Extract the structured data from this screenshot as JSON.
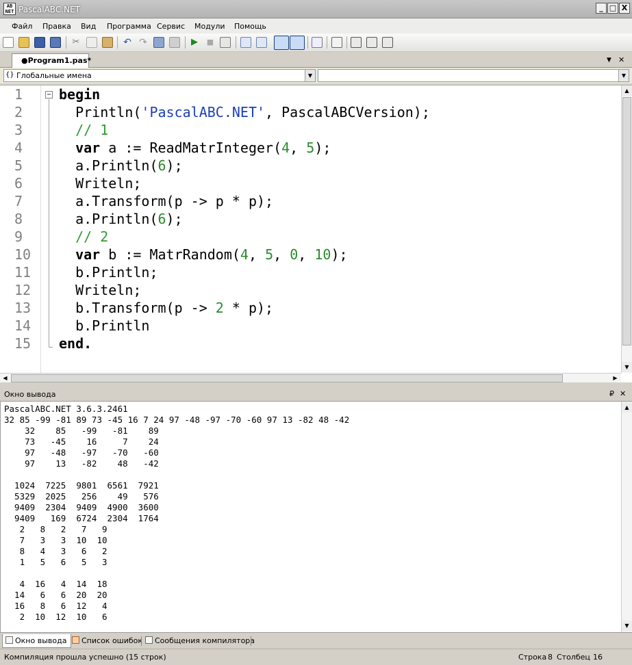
{
  "window": {
    "title": "PascalABC.NET",
    "icon_text": "AB\nNET"
  },
  "window_buttons": {
    "minimize": "_",
    "maximize": "□",
    "close": "X"
  },
  "menu": [
    "Файл",
    "Правка",
    "Вид",
    "Программа",
    "Сервис",
    "Модули",
    "Помощь"
  ],
  "toolbar": {
    "icons": [
      "new-file-icon",
      "open-file-icon",
      "save-icon",
      "save-all-icon",
      "cut-icon",
      "copy-icon",
      "paste-icon",
      "undo-icon",
      "redo-icon",
      "find-icon",
      "replace-icon",
      "run-icon",
      "stop-icon",
      "compile-icon",
      "step-over-icon",
      "step-into-icon",
      "toggle-output-icon",
      "toggle-input-icon",
      "format-icon",
      "form-designer-icon",
      "debug-1-icon",
      "debug-2-icon",
      "debug-3-icon"
    ],
    "run_color": "#1a8a1a"
  },
  "document_tab": {
    "label": "●Program1.pas*",
    "menu_glyph": "▼",
    "close_glyph": "✕"
  },
  "scope_combo": {
    "value": "Глобальные имена",
    "icon": "{}"
  },
  "member_combo": {
    "value": ""
  },
  "editor": {
    "line_numbers": [
      "1",
      "2",
      "3",
      "4",
      "5",
      "6",
      "7",
      "8",
      "9",
      "10",
      "11",
      "12",
      "13",
      "14",
      "15"
    ],
    "lines": [
      [
        {
          "t": "begin",
          "c": "kw"
        }
      ],
      [
        {
          "t": "  Println("
        },
        {
          "t": "'PascalABC.NET'",
          "c": "str"
        },
        {
          "t": ", PascalABCVersion);"
        }
      ],
      [
        {
          "t": "  // 1",
          "c": "cm"
        }
      ],
      [
        {
          "t": "  "
        },
        {
          "t": "var",
          "c": "kw"
        },
        {
          "t": " a := ReadMatrInteger("
        },
        {
          "t": "4",
          "c": "num"
        },
        {
          "t": ", "
        },
        {
          "t": "5",
          "c": "num"
        },
        {
          "t": ");"
        }
      ],
      [
        {
          "t": "  a.Println("
        },
        {
          "t": "6",
          "c": "num"
        },
        {
          "t": ");"
        }
      ],
      [
        {
          "t": "  Writeln;"
        }
      ],
      [
        {
          "t": "  a.Transform(p -> p * p);"
        }
      ],
      [
        {
          "t": "  a.Println("
        },
        {
          "t": "6",
          "c": "num"
        },
        {
          "t": ");"
        }
      ],
      [
        {
          "t": "  // 2",
          "c": "cm"
        }
      ],
      [
        {
          "t": "  "
        },
        {
          "t": "var",
          "c": "kw"
        },
        {
          "t": " b := MatrRandom("
        },
        {
          "t": "4",
          "c": "num"
        },
        {
          "t": ", "
        },
        {
          "t": "5",
          "c": "num"
        },
        {
          "t": ", "
        },
        {
          "t": "0",
          "c": "num"
        },
        {
          "t": ", "
        },
        {
          "t": "10",
          "c": "num"
        },
        {
          "t": ");"
        }
      ],
      [
        {
          "t": "  b.Println;"
        }
      ],
      [
        {
          "t": "  Writeln;"
        }
      ],
      [
        {
          "t": "  b.Transform(p -> "
        },
        {
          "t": "2",
          "c": "num"
        },
        {
          "t": " * p);"
        }
      ],
      [
        {
          "t": "  b.Println"
        }
      ],
      [
        {
          "t": "end.",
          "c": "kw"
        }
      ]
    ]
  },
  "output_panel": {
    "title": "Окно вывода",
    "pin_glyph": "₽",
    "close_glyph": "✕",
    "lines": [
      "PascalABC.NET 3.6.3.2461",
      "32 85 -99 -81 89 73 -45 16 7 24 97 -48 -97 -70 -60 97 13 -82 48 -42",
      "    32    85   -99   -81    89",
      "    73   -45    16     7    24",
      "    97   -48   -97   -70   -60",
      "    97    13   -82    48   -42",
      "",
      "  1024  7225  9801  6561  7921",
      "  5329  2025   256    49   576",
      "  9409  2304  9409  4900  3600",
      "  9409   169  6724  2304  1764",
      "   2   8   2   7   9",
      "   7   3   3  10  10",
      "   8   4   3   6   2",
      "   1   5   6   5   3",
      "",
      "   4  16   4  14  18",
      "  14   6   6  20  20",
      "  16   8   6  12   4",
      "   2  10  12  10   6"
    ]
  },
  "bottom_tabs": [
    "Окно вывода",
    "Список ошибок",
    "Сообщения компилятора"
  ],
  "status": {
    "message": "Компиляция прошла успешно (15 строк)",
    "row_label": "Строка",
    "row_value": "8",
    "col_label": "Столбец",
    "col_value": "16"
  }
}
